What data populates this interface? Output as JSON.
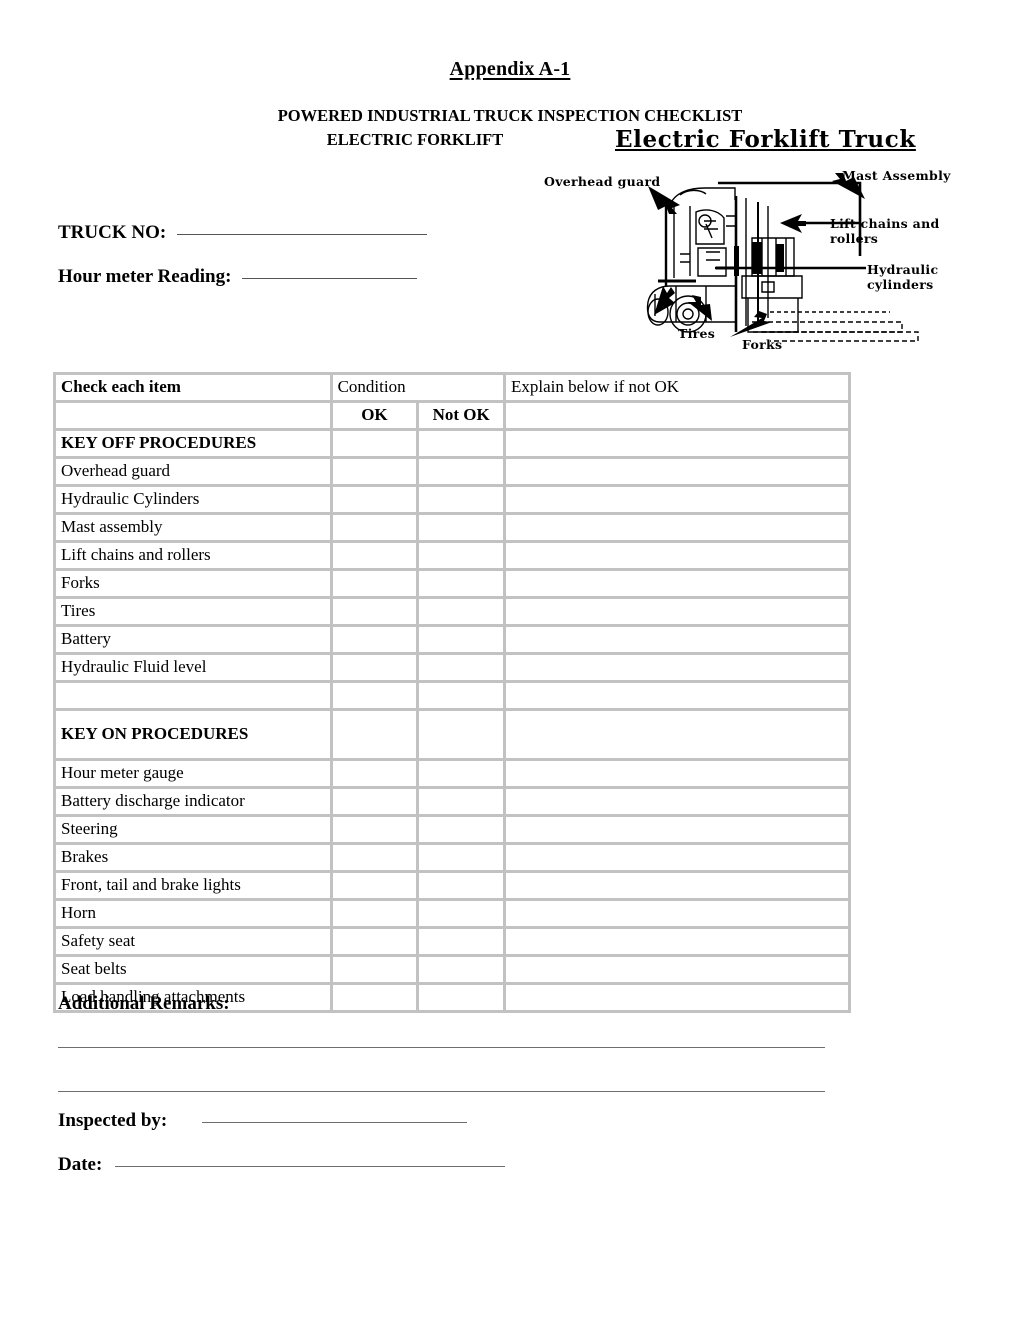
{
  "header": {
    "appendix_title": "Appendix A-1",
    "subtitle_line1": "POWERED INDUSTRIAL TRUCK INSPECTION CHECKLIST",
    "subtitle_line2": "ELECTRIC FORKLIFT"
  },
  "form_fields": {
    "truck_no_label": "TRUCK NO:",
    "truck_no_value": "",
    "hour_meter_label": "Hour meter Reading:",
    "hour_meter_value": ""
  },
  "illustration": {
    "title": "Electric Forklift Truck",
    "labels": {
      "overhead_guard": "Overhead guard",
      "mast_assembly": "Mast Assembly",
      "lift_chains_line1": "Lift chains and",
      "lift_chains_line2": "rollers",
      "hydraulic_line1": "Hydraulic",
      "hydraulic_line2": "cylinders",
      "tires": "Tires",
      "forks": "Forks"
    }
  },
  "table": {
    "headers": {
      "item": "Check each item",
      "condition": "Condition",
      "explain": "Explain below if not OK",
      "ok": "OK",
      "not_ok": "Not OK"
    },
    "sections": [
      {
        "title": "KEY OFF PROCEDURES",
        "tall": false,
        "items": [
          "Overhead guard",
          "Hydraulic Cylinders",
          "Mast assembly",
          "Lift chains and rollers",
          "Forks",
          "Tires",
          "Battery",
          "Hydraulic Fluid level",
          ""
        ]
      },
      {
        "title": "KEY ON PROCEDURES",
        "tall": true,
        "items": [
          "Hour meter gauge",
          "Battery discharge indicator",
          "Steering",
          "Brakes",
          "Front, tail and brake lights",
          "Horn",
          "Safety seat",
          "Seat belts",
          "Load handling attachments"
        ]
      }
    ]
  },
  "footer": {
    "remarks_label": "Additional Remarks:",
    "remarks_line1": "",
    "remarks_line2": "",
    "inspected_by_label": "Inspected by:",
    "inspected_by_value": "",
    "date_label": "Date:",
    "date_value": ""
  },
  "colors": {
    "table_border": "#c2c2c2",
    "rule": "#6e6e6e",
    "text": "#000000"
  }
}
